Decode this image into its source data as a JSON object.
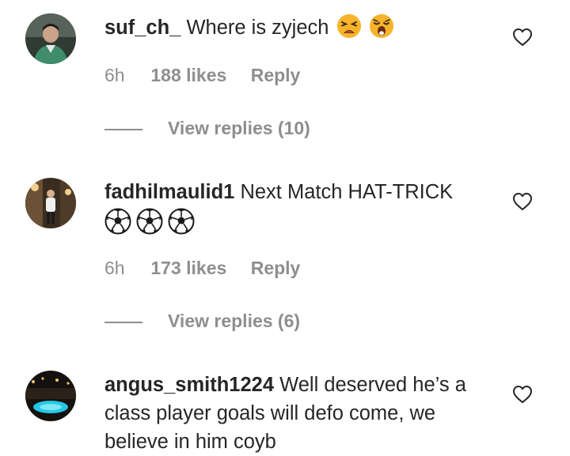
{
  "comments": [
    {
      "username": "suf_ch_",
      "text": "Where is zyjech",
      "time": "6h",
      "likes": "188 likes",
      "reply": "Reply",
      "view_replies": "View replies (10)",
      "emojis": [
        "tired-face-emoji",
        "weary-face-emoji"
      ]
    },
    {
      "username": "fadhilmaulid1",
      "text": "Next Match HAT-TRICK",
      "time": "6h",
      "likes": "173 likes",
      "reply": "Reply",
      "view_replies": "View replies (6)",
      "emojis": [
        "soccer-ball-emoji",
        "soccer-ball-emoji",
        "soccer-ball-emoji"
      ]
    },
    {
      "username": "angus_smith1224",
      "text": "Well deserved he’s a class player goals will defo come, we believe in him coyb"
    }
  ],
  "icons": {
    "like": "heart-outline-icon"
  },
  "colors": {
    "text": "#262626",
    "muted": "#8e8e8e",
    "background": "#ffffff"
  }
}
